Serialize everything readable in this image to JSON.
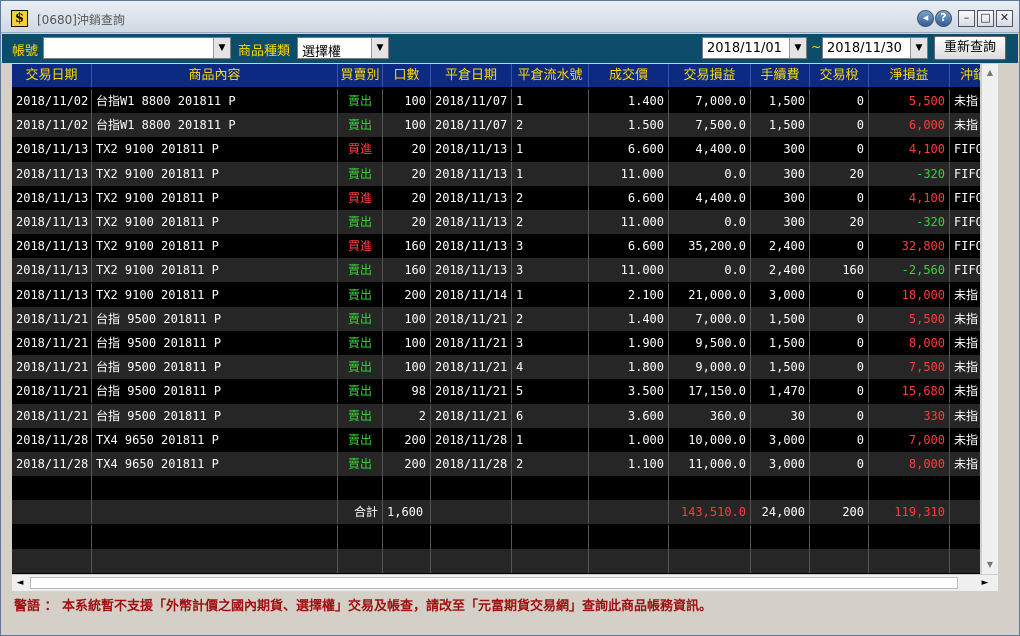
{
  "window": {
    "title": "[0680]沖銷查詢",
    "icon_letter": "$",
    "buttons": {
      "back": "◂",
      "help": "?",
      "min": "–",
      "max": "□",
      "close": "✕"
    }
  },
  "toolbar": {
    "account_label": "帳號",
    "account_value": "",
    "product_type_label": "商品種類",
    "product_type_value": "選擇權",
    "date_from": "2018/11/01",
    "date_separator": "~",
    "date_to": "2018/11/30",
    "requery_label": "重新查詢"
  },
  "grid": {
    "headers": [
      "交易日期",
      "商品內容",
      "買賣別",
      "口數",
      "平倉日期",
      "平倉流水號",
      "成交價",
      "交易損益",
      "手續費",
      "交易稅",
      "淨損益",
      "沖銷類"
    ],
    "rows": [
      {
        "date": "2018/11/02",
        "product": "台指W1 8800 201811 P",
        "side": "賣出",
        "qty": "100",
        "close_date": "2018/11/07",
        "serial": "1",
        "price": "1.400",
        "pnl": "7,000.0",
        "fee": "1,500",
        "tax": "0",
        "net": "5,500",
        "type": "未指"
      },
      {
        "date": "2018/11/02",
        "product": "台指W1 8800 201811 P",
        "side": "賣出",
        "qty": "100",
        "close_date": "2018/11/07",
        "serial": "2",
        "price": "1.500",
        "pnl": "7,500.0",
        "fee": "1,500",
        "tax": "0",
        "net": "6,000",
        "type": "未指"
      },
      {
        "date": "2018/11/13",
        "product": "TX2  9100 201811 P",
        "side": "買進",
        "qty": "20",
        "close_date": "2018/11/13",
        "serial": "1",
        "price": "6.600",
        "pnl": "4,400.0",
        "fee": "300",
        "tax": "0",
        "net": "4,100",
        "type": "FIFO"
      },
      {
        "date": "2018/11/13",
        "product": "TX2  9100 201811 P",
        "side": "賣出",
        "qty": "20",
        "close_date": "2018/11/13",
        "serial": "1",
        "price": "11.000",
        "pnl": "0.0",
        "fee": "300",
        "tax": "20",
        "net": "-320",
        "type": "FIFO"
      },
      {
        "date": "2018/11/13",
        "product": "TX2  9100 201811 P",
        "side": "買進",
        "qty": "20",
        "close_date": "2018/11/13",
        "serial": "2",
        "price": "6.600",
        "pnl": "4,400.0",
        "fee": "300",
        "tax": "0",
        "net": "4,100",
        "type": "FIFO"
      },
      {
        "date": "2018/11/13",
        "product": "TX2  9100 201811 P",
        "side": "賣出",
        "qty": "20",
        "close_date": "2018/11/13",
        "serial": "2",
        "price": "11.000",
        "pnl": "0.0",
        "fee": "300",
        "tax": "20",
        "net": "-320",
        "type": "FIFO"
      },
      {
        "date": "2018/11/13",
        "product": "TX2  9100 201811 P",
        "side": "買進",
        "qty": "160",
        "close_date": "2018/11/13",
        "serial": "3",
        "price": "6.600",
        "pnl": "35,200.0",
        "fee": "2,400",
        "tax": "0",
        "net": "32,800",
        "type": "FIFO"
      },
      {
        "date": "2018/11/13",
        "product": "TX2  9100 201811 P",
        "side": "賣出",
        "qty": "160",
        "close_date": "2018/11/13",
        "serial": "3",
        "price": "11.000",
        "pnl": "0.0",
        "fee": "2,400",
        "tax": "160",
        "net": "-2,560",
        "type": "FIFO"
      },
      {
        "date": "2018/11/13",
        "product": "TX2  9100 201811 P",
        "side": "賣出",
        "qty": "200",
        "close_date": "2018/11/14",
        "serial": "1",
        "price": "2.100",
        "pnl": "21,000.0",
        "fee": "3,000",
        "tax": "0",
        "net": "18,000",
        "type": "未指"
      },
      {
        "date": "2018/11/21",
        "product": "台指 9500 201811 P",
        "side": "賣出",
        "qty": "100",
        "close_date": "2018/11/21",
        "serial": "2",
        "price": "1.400",
        "pnl": "7,000.0",
        "fee": "1,500",
        "tax": "0",
        "net": "5,500",
        "type": "未指"
      },
      {
        "date": "2018/11/21",
        "product": "台指 9500 201811 P",
        "side": "賣出",
        "qty": "100",
        "close_date": "2018/11/21",
        "serial": "3",
        "price": "1.900",
        "pnl": "9,500.0",
        "fee": "1,500",
        "tax": "0",
        "net": "8,000",
        "type": "未指"
      },
      {
        "date": "2018/11/21",
        "product": "台指 9500 201811 P",
        "side": "賣出",
        "qty": "100",
        "close_date": "2018/11/21",
        "serial": "4",
        "price": "1.800",
        "pnl": "9,000.0",
        "fee": "1,500",
        "tax": "0",
        "net": "7,500",
        "type": "未指"
      },
      {
        "date": "2018/11/21",
        "product": "台指 9500 201811 P",
        "side": "賣出",
        "qty": "98",
        "close_date": "2018/11/21",
        "serial": "5",
        "price": "3.500",
        "pnl": "17,150.0",
        "fee": "1,470",
        "tax": "0",
        "net": "15,680",
        "type": "未指"
      },
      {
        "date": "2018/11/21",
        "product": "台指 9500 201811 P",
        "side": "賣出",
        "qty": "2",
        "close_date": "2018/11/21",
        "serial": "6",
        "price": "3.600",
        "pnl": "360.0",
        "fee": "30",
        "tax": "0",
        "net": "330",
        "type": "未指"
      },
      {
        "date": "2018/11/28",
        "product": "TX4  9650 201811 P",
        "side": "賣出",
        "qty": "200",
        "close_date": "2018/11/28",
        "serial": "1",
        "price": "1.000",
        "pnl": "10,000.0",
        "fee": "3,000",
        "tax": "0",
        "net": "7,000",
        "type": "未指"
      },
      {
        "date": "2018/11/28",
        "product": "TX4  9650 201811 P",
        "side": "賣出",
        "qty": "200",
        "close_date": "2018/11/28",
        "serial": "2",
        "price": "1.100",
        "pnl": "11,000.0",
        "fee": "3,000",
        "tax": "0",
        "net": "8,000",
        "type": "未指"
      }
    ],
    "total": {
      "label": "合計",
      "qty": "1,600",
      "pnl": "143,510.0",
      "fee": "24,000",
      "tax": "200",
      "net": "119,310"
    }
  },
  "scroll": {
    "up": "▲",
    "down": "▼",
    "left": "◄",
    "right": "►"
  },
  "warning": "警語 ： 本系統暫不支援「外幣計價之國內期貨、選擇權」交易及帳查，請改至「元富期貨交易網」查詢此商品帳務資訊。"
}
